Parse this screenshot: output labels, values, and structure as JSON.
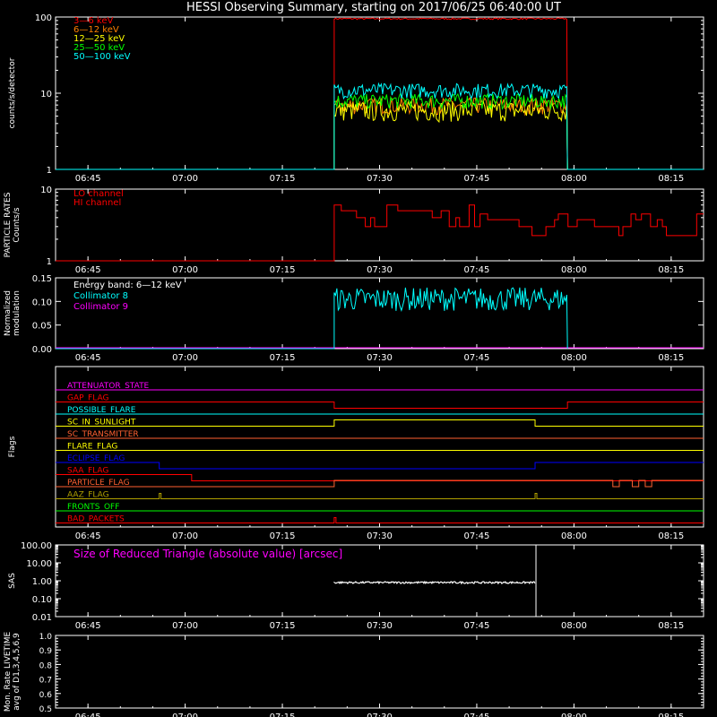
{
  "title": "HESSI Observing Summary, starting on 2017/06/25 06:40:00 UT",
  "time_axis": {
    "start": "06:40",
    "end": "08:20",
    "ticks": [
      "06:45",
      "07:00",
      "07:15",
      "07:30",
      "07:45",
      "08:00",
      "08:15"
    ]
  },
  "colors": {
    "white": "#ffffff",
    "red": "#ff0000",
    "orange": "#ff8000",
    "yellow": "#ffff00",
    "green": "#00ff00",
    "cyan": "#00ffff",
    "magenta": "#ff00ff",
    "blue": "#0000ff",
    "olive": "#b0a000",
    "salmon": "#ff6030"
  },
  "chart_data": [
    {
      "type": "line",
      "ylabel": "counts/s/detector",
      "scale": "log",
      "ylim": [
        1,
        100
      ],
      "yticks": [
        "1",
        "10",
        "100"
      ],
      "legend_position": "top-left",
      "series": [
        {
          "name": "3—6 keV",
          "color": "#ff0000",
          "level_during_obs": 95
        },
        {
          "name": "6—12 keV",
          "color": "#ff8000",
          "level_during_obs": 7
        },
        {
          "name": "12—25 keV",
          "color": "#ffff00",
          "level_during_obs": 6
        },
        {
          "name": "25—50 keV",
          "color": "#00ff00",
          "level_during_obs": 8
        },
        {
          "name": "50—100 keV",
          "color": "#00ffff",
          "level_during_obs": 11
        }
      ],
      "observation_window": [
        "07:23",
        "07:59"
      ]
    },
    {
      "type": "line",
      "ylabel": "PARTICLE RATES\nCounts/s",
      "scale": "log",
      "ylim": [
        1,
        10
      ],
      "yticks": [
        "1",
        "10"
      ],
      "legend_position": "top-left",
      "series": [
        {
          "name": "LO channel",
          "color": "#ff0000"
        },
        {
          "name": "HI channel",
          "color": "#ff0000",
          "level": 4
        }
      ],
      "start": "07:23"
    },
    {
      "type": "line",
      "ylabel": "Normalized\nmodulation",
      "ylim": [
        0,
        0.15
      ],
      "yticks": [
        "0.00",
        "0.05",
        "0.10",
        "0.15"
      ],
      "legend_position": "top-left",
      "legend_header": "Energy band: 6—12 keV",
      "series": [
        {
          "name": "Collimator 8",
          "color": "#00ffff",
          "level_during_obs": 0.105
        },
        {
          "name": "Collimator 9",
          "color": "#ff00ff",
          "level": 0
        }
      ],
      "observation_window": [
        "07:23",
        "07:59"
      ]
    },
    {
      "type": "flags",
      "ylabel": "Flags",
      "flags": [
        {
          "name": "ATTENUATOR_STATE",
          "color": "#ff00ff"
        },
        {
          "name": "GAP_FLAG",
          "color": "#ff0000",
          "low_during": [
            "07:23",
            "07:59"
          ]
        },
        {
          "name": "POSSIBLE_FLARE",
          "color": "#00ffff"
        },
        {
          "name": "SC_IN_SUNLIGHT",
          "color": "#ffff00",
          "high_during": [
            "07:23",
            "07:54"
          ]
        },
        {
          "name": "SC_TRANSMITTER",
          "color": "#ff6030"
        },
        {
          "name": "FLARE_FLAG",
          "color": "#ffff00"
        },
        {
          "name": "ECLIPSE_FLAG",
          "color": "#0000ff",
          "low_during": [
            "06:56",
            "07:54"
          ]
        },
        {
          "name": "SAA_FLAG",
          "color": "#ff0000",
          "low_after": "07:01"
        },
        {
          "name": "PARTICLE_FLAG",
          "color": "#ff6030",
          "high_during": [
            "07:23",
            "08:20"
          ]
        },
        {
          "name": "AAZ_FLAG",
          "color": "#b0a000",
          "spikes": [
            "06:56",
            "07:54"
          ]
        },
        {
          "name": "FRONTS_OFF",
          "color": "#00ff00"
        },
        {
          "name": "BAD_PACKETS",
          "color": "#ff0000",
          "spikes": [
            "07:23"
          ]
        }
      ]
    },
    {
      "type": "line",
      "ylabel": "SAS",
      "scale": "log",
      "ylim": [
        0.01,
        100
      ],
      "yticks": [
        "0.01",
        "0.10",
        "1.00",
        "10.00",
        "100.00"
      ],
      "annotation": "Size of Reduced Triangle (absolute value) [arcsec]",
      "series": [
        {
          "color": "#ffffff",
          "level_during_obs": 0.8
        }
      ],
      "observation_window": [
        "07:23",
        "07:54"
      ]
    },
    {
      "type": "line",
      "ylabel": "Mon. Rate LIVETIME\navg of D1,3,4,5,6,9",
      "ylim": [
        0.5,
        1.0
      ],
      "yticks": [
        "0.5",
        "0.6",
        "0.7",
        "0.8",
        "0.9",
        "1.0"
      ],
      "series": []
    }
  ]
}
